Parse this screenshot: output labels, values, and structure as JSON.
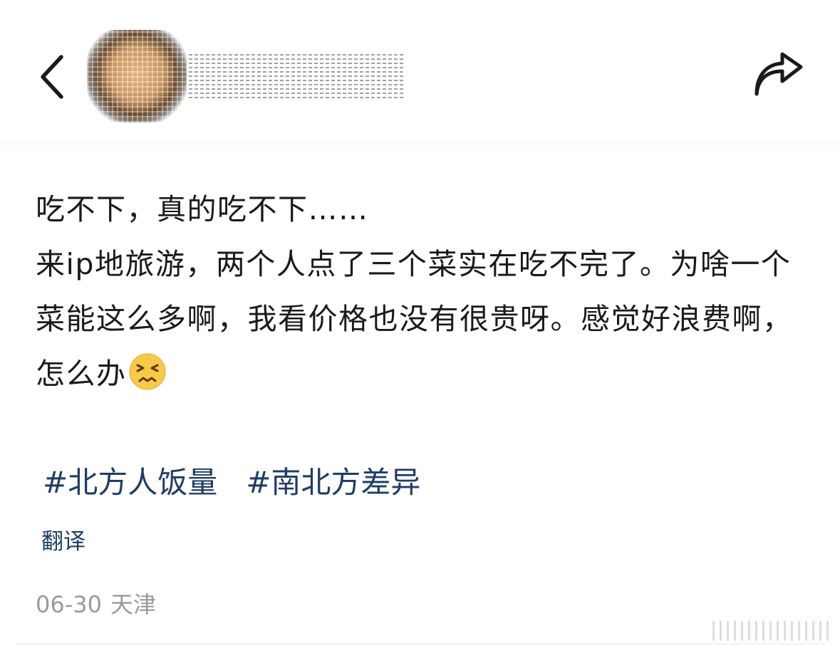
{
  "header": {
    "back_icon": "chevron-left-icon",
    "share_icon": "share-arrow-icon"
  },
  "post": {
    "lines": [
      "吃不下，真的吃不下……",
      "来ip地旅游，两个人点了三个菜实在吃不完了。为啥一个菜能这么多啊，我看价格也没有很贵呀。感觉好浪费啊，怎么办"
    ],
    "emoji": "persevering-face-emoji"
  },
  "tags": [
    "#北方人饭量",
    "#南北方差异"
  ],
  "translate_label": "翻译",
  "meta": {
    "date": "06-30",
    "location": "天津"
  },
  "colors": {
    "tag": "#1f3d66",
    "meta": "#9a9a9a",
    "text": "#1a1a1a"
  }
}
